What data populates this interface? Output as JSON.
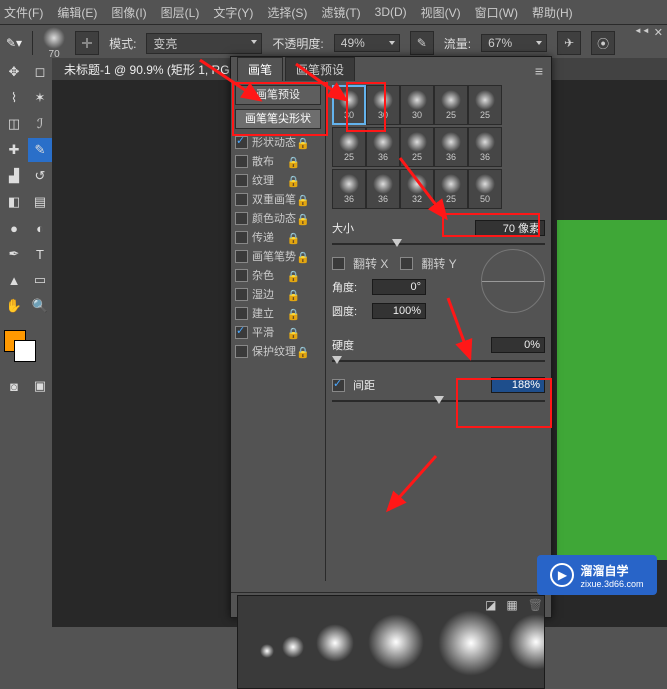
{
  "menubar": {
    "items": [
      "文件(F)",
      "编辑(E)",
      "图像(I)",
      "图层(L)",
      "文字(Y)",
      "选择(S)",
      "滤镜(T)",
      "3D(D)",
      "视图(V)",
      "窗口(W)",
      "帮助(H)"
    ]
  },
  "options": {
    "brush_preview_size": "70",
    "mode_label": "模式:",
    "mode_value": "变亮",
    "opacity_label": "不透明度:",
    "opacity_value": "49%",
    "flow_label": "流量:",
    "flow_value": "67%"
  },
  "doc_tab": "未标题-1 @ 90.9% (矩形 1, RG...",
  "panel": {
    "tabs": [
      "画笔",
      "画笔预设"
    ],
    "active_tab": 0,
    "left_header1": "画笔预设",
    "left_header2": "画笔笔尖形状",
    "options": [
      {
        "label": "形状动态",
        "checked": true
      },
      {
        "label": "散布",
        "checked": false
      },
      {
        "label": "纹理",
        "checked": false
      },
      {
        "label": "双重画笔",
        "checked": false
      },
      {
        "label": "颜色动态",
        "checked": false
      },
      {
        "label": "传递",
        "checked": false
      },
      {
        "label": "画笔笔势",
        "checked": false
      },
      {
        "label": "杂色",
        "checked": false
      },
      {
        "label": "湿边",
        "checked": false
      },
      {
        "label": "建立",
        "checked": false
      },
      {
        "label": "平滑",
        "checked": true
      },
      {
        "label": "保护纹理",
        "checked": false
      }
    ],
    "brush_grid": [
      [
        "30",
        "30",
        "30",
        "25",
        "25"
      ],
      [
        "25",
        "36",
        "25",
        "36",
        "36"
      ],
      [
        "36",
        "36",
        "32",
        "25",
        "50"
      ]
    ],
    "selected_brush": "30",
    "size_label": "大小",
    "size_value": "70 像素",
    "flip_x": "翻转 X",
    "flip_y": "翻转 Y",
    "angle_label": "角度:",
    "angle_value": "0°",
    "roundness_label": "圆度:",
    "roundness_value": "100%",
    "hardness_label": "硬度",
    "hardness_value": "0%",
    "spacing_label": "间距",
    "spacing_value": "188%"
  },
  "watermark": {
    "name": "溜溜自学",
    "url": "zixue.3d66.com"
  },
  "chart_data": null
}
